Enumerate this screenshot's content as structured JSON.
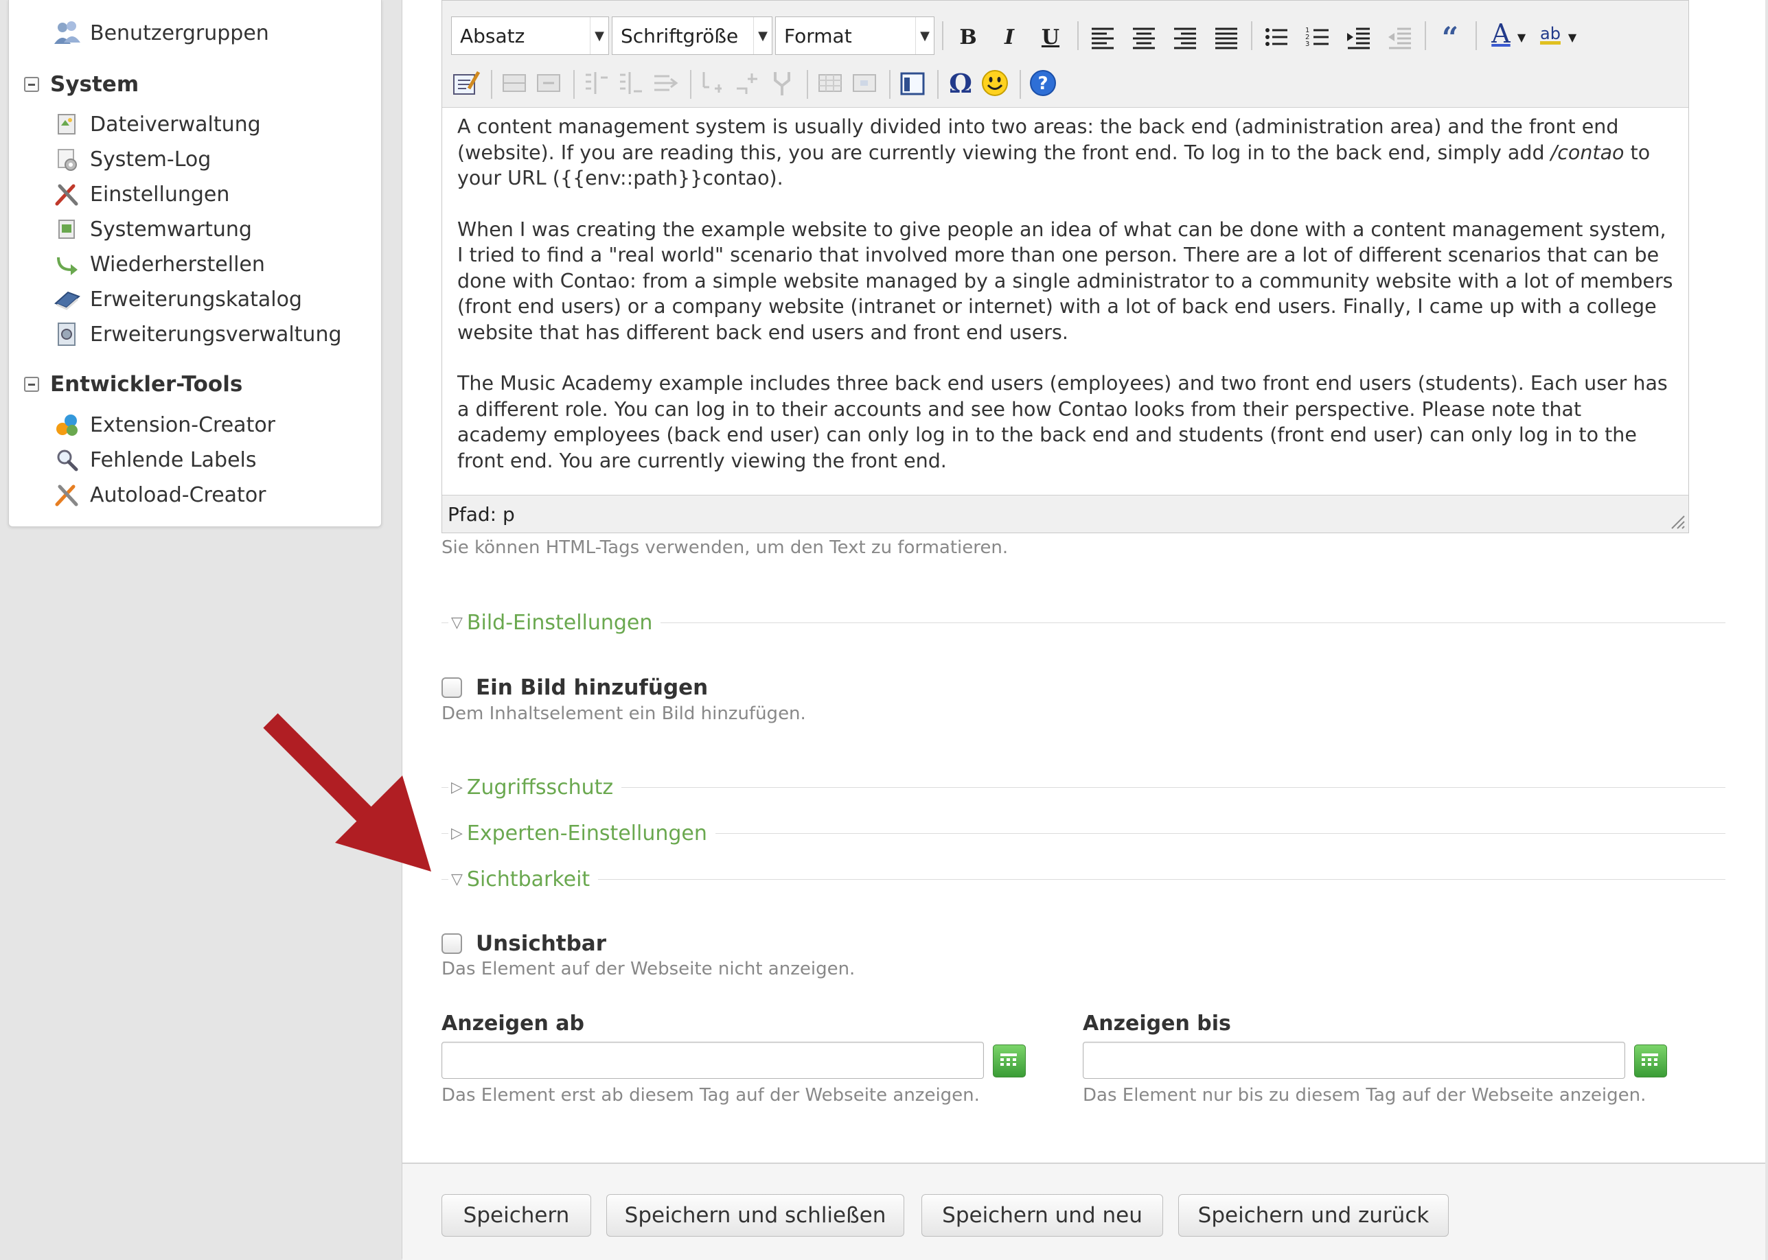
{
  "sidebar": {
    "top_item": {
      "label": "Benutzergruppen",
      "icon": "user-group-icon"
    },
    "groups": [
      {
        "title": "System",
        "items": [
          {
            "label": "Dateiverwaltung",
            "icon": "file-manager-icon"
          },
          {
            "label": "System-Log",
            "icon": "system-log-icon"
          },
          {
            "label": "Einstellungen",
            "icon": "settings-tools-icon"
          },
          {
            "label": "Systemwartung",
            "icon": "maintenance-icon"
          },
          {
            "label": "Wiederherstellen",
            "icon": "restore-icon"
          },
          {
            "label": "Erweiterungskatalog",
            "icon": "extension-catalog-icon"
          },
          {
            "label": "Erweiterungsverwaltung",
            "icon": "extension-manager-icon"
          }
        ]
      },
      {
        "title": "Entwickler-Tools",
        "items": [
          {
            "label": "Extension-Creator",
            "icon": "extension-creator-icon"
          },
          {
            "label": "Fehlende Labels",
            "icon": "search-icon"
          },
          {
            "label": "Autoload-Creator",
            "icon": "autoload-tools-icon"
          }
        ]
      }
    ]
  },
  "editor": {
    "selects": {
      "block": "Absatz",
      "font_size": "Schriftgröße",
      "format": "Format"
    },
    "buttons": {
      "bold": "B",
      "italic": "I",
      "underline": "U",
      "omega": "Ω",
      "quote": "“",
      "text_color": "A",
      "highlight": "ab"
    },
    "paragraphs": [
      {
        "before": "A content management system is usually divided into two areas: the back end (administration area) and the front end (website). If you are reading this, you are currently viewing the front end. To log in to the back end, simply add ",
        "em": "/contao",
        "after": " to your URL ({{env::path}}contao)."
      },
      {
        "before": "When I was creating the example website to give people an idea of what can be done with a content management system, I tried to find a \"real world\" scenario that involved more than one person. There are a lot of different scenarios that can be done with Contao: from a simple website managed by a single administrator to a community website with a lot of members (front end users) or a company website (intranet or internet) with a lot of back end users. Finally, I came up with a college website that has different back end users and front end users.",
        "em": "",
        "after": ""
      },
      {
        "before": "The Music Academy example includes three back end users (employees) and two front end users (students). Each user has a different role. You can log in to their accounts and see how Contao looks from their perspective. Please note that academy employees (back end user) can only log in to the back end and students (front end user) can only log in to the front end. You are currently viewing the front end.",
        "em": "",
        "after": ""
      }
    ],
    "path_label": "Pfad: p",
    "help": "Sie können HTML-Tags verwenden, um den Text zu formatieren."
  },
  "sections": {
    "image_settings": {
      "label": "Bild-Einstellungen",
      "expanded": true
    },
    "add_image": {
      "label": "Ein Bild hinzufügen",
      "help": "Dem Inhaltselement ein Bild hinzufügen.",
      "checked": false
    },
    "access": {
      "label": "Zugriffsschutz",
      "expanded": false
    },
    "expert": {
      "label": "Experten-Einstellungen",
      "expanded": false
    },
    "visibility": {
      "label": "Sichtbarkeit",
      "expanded": true
    },
    "invisible": {
      "label": "Unsichtbar",
      "help": "Das Element auf der Webseite nicht anzeigen.",
      "checked": false
    },
    "show_from": {
      "label": "Anzeigen ab",
      "value": "",
      "help": "Das Element erst ab diesem Tag auf der Webseite anzeigen."
    },
    "show_until": {
      "label": "Anzeigen bis",
      "value": "",
      "help": "Das Element nur bis zu diesem Tag auf der Webseite anzeigen."
    }
  },
  "actions": {
    "save": "Speichern",
    "save_close": "Speichern und schließen",
    "save_new": "Speichern und neu",
    "save_back": "Speichern und zurück"
  },
  "colors": {
    "legend_green": "#6aa84f",
    "arrow_red": "#b01e23",
    "date_button_green": "#3a9c36"
  }
}
